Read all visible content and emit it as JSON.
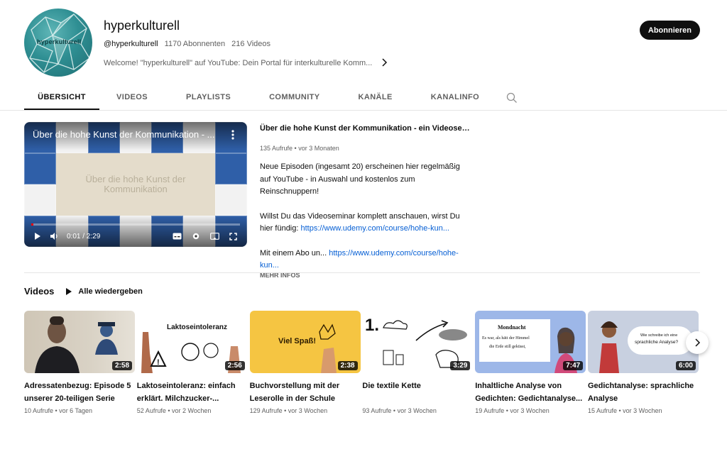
{
  "channel": {
    "name": "hyperkulturell",
    "handle": "@hyperkulturell",
    "subscribers": "1170 Abonnenten",
    "videos": "216 Videos",
    "description": "Welcome! \"hyperkulturell\" auf YouTube: Dein Portal für interkulturelle Komm...",
    "avatar_text": "hyperkulturell",
    "subscribe_label": "Abonnieren"
  },
  "tabs": [
    {
      "label": "ÜBERSICHT",
      "active": true
    },
    {
      "label": "VIDEOS"
    },
    {
      "label": "PLAYLISTS"
    },
    {
      "label": "COMMUNITY"
    },
    {
      "label": "KANÄLE"
    },
    {
      "label": "KANALINFO"
    }
  ],
  "featured": {
    "player_title": "Über die hohe Kunst der Kommunikation - ...",
    "center_text": "Über die hohe Kunst der Kommunikation",
    "time": "0:01 / 2:29",
    "progress": 0.01,
    "title": "Über die hohe Kunst der Kommunikation - ein Videoseminar i...",
    "meta": "135 Aufrufe • vor 3 Monaten",
    "desc1": "Neue Episoden (ingesamt 20) erscheinen hier regelmäßig auf YouTube - in Auswahl und kostenlos zum Reinschnuppern!",
    "desc2_text": "Willst Du das Videoseminar komplett anschauen, wirst Du hier fündig: ",
    "desc2_link": "https://www.udemy.com/course/hohe-kun...",
    "desc3_text": "Mit einem Abo un...",
    "desc3_link": "https://www.udemy.com/course/hohe-kun...",
    "more_info": "MEHR INFOS"
  },
  "shelf": {
    "title": "Videos",
    "play_all": "Alle wiedergeben"
  },
  "videos": [
    {
      "title": "Adressatenbezug: Episode 5 unserer 20-teiligen Serie",
      "meta": "10 Aufrufe • vor 6 Tagen",
      "duration": "2:58"
    },
    {
      "title": "Laktoseintoleranz: einfach erklärt. Milchzucker-...",
      "meta": "52 Aufrufe • vor 2 Wochen",
      "duration": "2:56",
      "thumb_text": "Laktoseintoleranz"
    },
    {
      "title": "Buchvorstellung mit der Leserolle in der Schule",
      "meta": "129 Aufrufe • vor 3 Wochen",
      "duration": "2:38",
      "thumb_text": "Viel Spaß!"
    },
    {
      "title": "Die textile Kette",
      "meta": "93 Aufrufe • vor 3 Wochen",
      "duration": "3:29",
      "thumb_text": "1."
    },
    {
      "title": "Inhaltliche Analyse von Gedichten: Gedichtanalyse...",
      "meta": "19 Aufrufe • vor 3 Wochen",
      "duration": "7:47",
      "thumb_text": "Mondnacht",
      "thumb_text2": "Es war, als hätt der Himmel die Erde still geküsst,"
    },
    {
      "title": "Gedichtanalyse: sprachliche Analyse",
      "meta": "15 Aufrufe • vor 3 Wochen",
      "duration": "6:00",
      "thumb_text": "Wie schreibe ich eine sprachliche Analyse?"
    }
  ]
}
